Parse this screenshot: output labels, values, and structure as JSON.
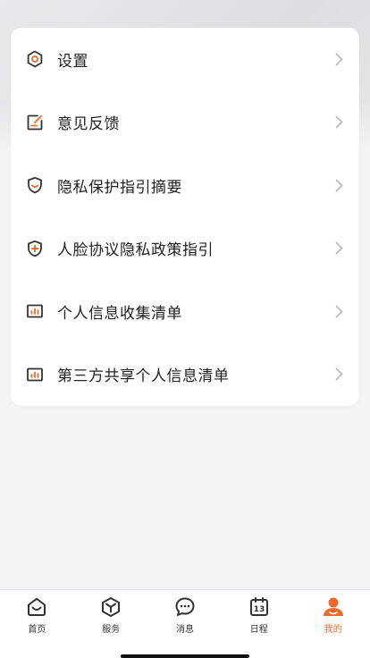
{
  "colors": {
    "accent": "#ee6a2c",
    "icon": "#333333",
    "chevron": "#b8b8b8",
    "text": "#222222"
  },
  "menu": {
    "items": [
      {
        "label": "设置",
        "icon": "settings-hexagon-icon"
      },
      {
        "label": "意见反馈",
        "icon": "feedback-icon"
      },
      {
        "label": "隐私保护指引摘要",
        "icon": "shield-icon"
      },
      {
        "label": "人脸协议隐私政策指引",
        "icon": "shield-plus-icon"
      },
      {
        "label": "个人信息收集清单",
        "icon": "chart-list-icon"
      },
      {
        "label": "第三方共享个人信息清单",
        "icon": "chart-list-icon"
      }
    ]
  },
  "tabbar": {
    "items": [
      {
        "label": "首页",
        "icon": "home-icon",
        "active": false
      },
      {
        "label": "服务",
        "icon": "cube-icon",
        "active": false
      },
      {
        "label": "消息",
        "icon": "message-icon",
        "active": false
      },
      {
        "label": "日程",
        "icon": "calendar-icon",
        "active": false,
        "badge_text": "13"
      },
      {
        "label": "我的",
        "icon": "profile-icon",
        "active": true
      }
    ]
  }
}
